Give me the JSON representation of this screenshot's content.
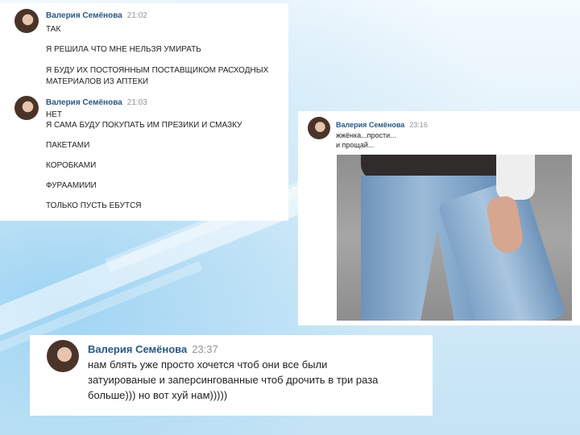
{
  "panel1": {
    "author": "Валерия Семёнова",
    "time1": "21:02",
    "lines1": [
      "ТАК",
      "Я РЕШИЛА ЧТО МНЕ НЕЛЬЗЯ УМИРАТЬ",
      "Я БУДУ ИХ ПОСТОЯННЫМ ПОСТАВЩИКОМ РАСХОДНЫХ",
      "МАТЕРИАЛОВ ИЗ АПТЕКИ"
    ],
    "time2": "21:03",
    "lines2": [
      "НЕТ",
      "Я САМА БУДУ ПОКУПАТЬ ИМ ПРЕЗИКИ И СМАЗКУ",
      "ПАКЕТАМИ",
      "КОРОБКАМИ",
      "ФУРААМИИИ",
      "ТОЛЬКО ПУСТЬ ЕБУТСЯ"
    ]
  },
  "panel2": {
    "author": "Валерия Семёнова",
    "time": "23:16",
    "lines": [
      "жжёнка...прости...",
      "и прощай..."
    ]
  },
  "panel3": {
    "author": "Валерия Семёнова",
    "time": "23:37",
    "lines": [
      "нам блять уже просто хочется чтоб они все были",
      "затуированые и заперсингованные чтоб дрочить в три раза",
      "больше))) но вот хуй нам)))))"
    ]
  }
}
